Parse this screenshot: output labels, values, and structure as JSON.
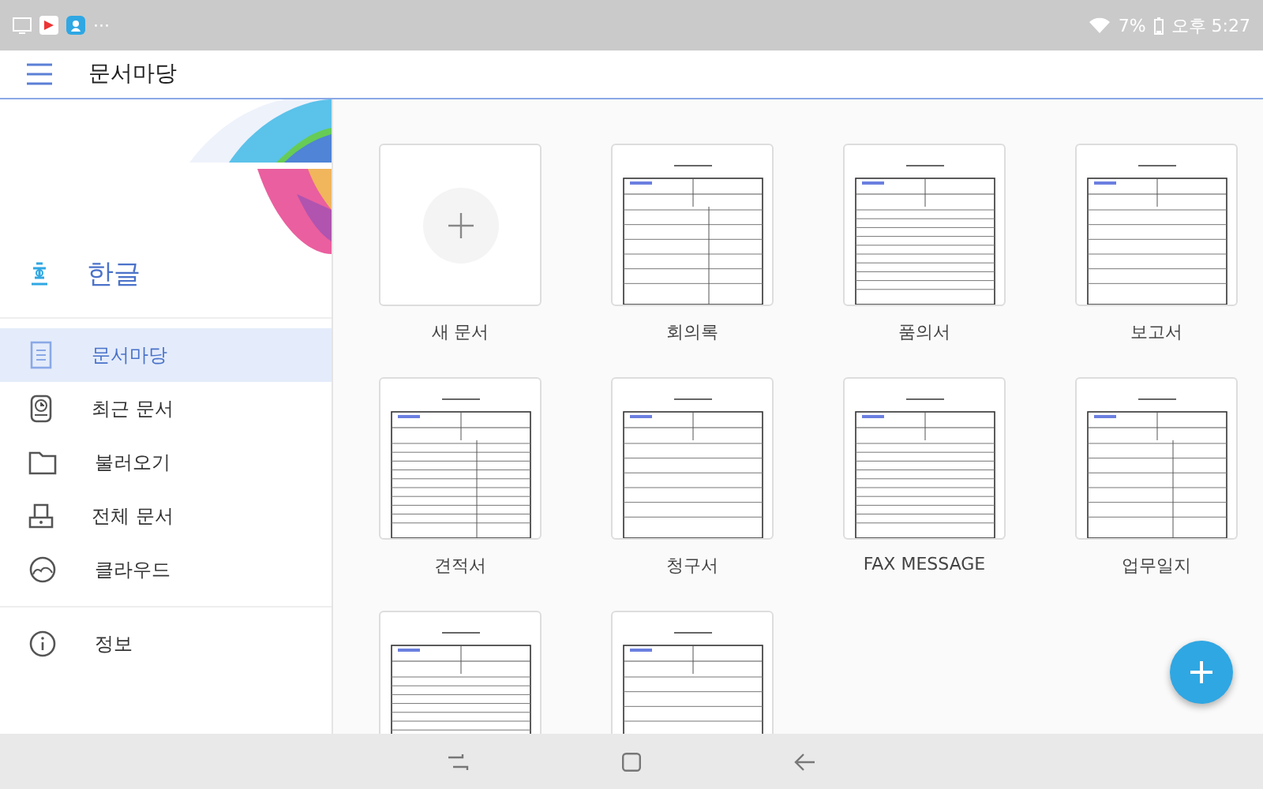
{
  "status_bar": {
    "notifications": "···",
    "battery": "7%",
    "time": "오후 5:27"
  },
  "app_bar": {
    "title": "문서마당"
  },
  "sidebar": {
    "brand": "한글",
    "items": [
      {
        "label": "문서마당",
        "kind": "document",
        "selected": true
      },
      {
        "label": "최근 문서",
        "kind": "recent",
        "selected": false
      },
      {
        "label": "불러오기",
        "kind": "open",
        "selected": false
      },
      {
        "label": "전체 문서",
        "kind": "all",
        "selected": false
      },
      {
        "label": "클라우드",
        "kind": "cloud",
        "selected": false
      }
    ],
    "footer_items": [
      {
        "label": "정보",
        "kind": "info",
        "selected": false
      }
    ]
  },
  "templates": [
    {
      "kind": "new",
      "label": "새 문서"
    },
    {
      "kind": "template",
      "label": "회의록"
    },
    {
      "kind": "template",
      "label": "품의서"
    },
    {
      "kind": "template",
      "label": "보고서"
    },
    {
      "kind": "template",
      "label": "견적서"
    },
    {
      "kind": "template",
      "label": "청구서"
    },
    {
      "kind": "template",
      "label": "FAX MESSAGE"
    },
    {
      "kind": "template",
      "label": "업무일지"
    },
    {
      "kind": "template"
    },
    {
      "kind": "template"
    }
  ]
}
